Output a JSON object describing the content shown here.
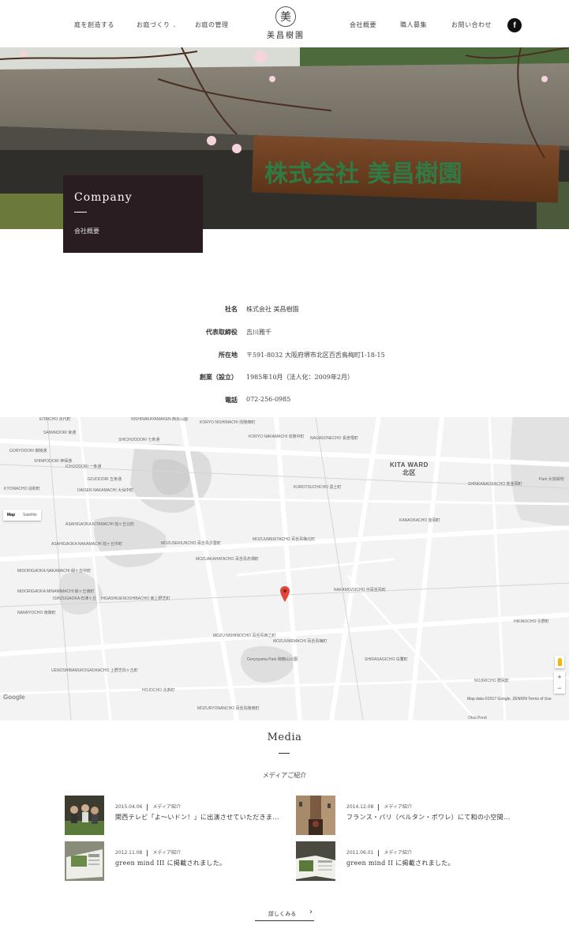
{
  "header": {
    "nav_left": [
      {
        "label": "庭を創造する"
      },
      {
        "label": "お庭づくり",
        "has_dropdown": true
      },
      {
        "label": "お庭の管理"
      }
    ],
    "logo_mark": "美",
    "logo_text": "美昌樹園",
    "nav_right": [
      {
        "label": "会社概要"
      },
      {
        "label": "職人募集"
      },
      {
        "label": "お問い合わせ"
      }
    ],
    "facebook_glyph": "f",
    "icons": {
      "facebook": "facebook-icon",
      "dropdown": "chevron-down-icon"
    }
  },
  "hero": {
    "title": "Company",
    "subtitle": "会社概要",
    "sign_text": "株式会社 美昌樹園",
    "label_bg": "#2a1d22"
  },
  "company_info": [
    {
      "label": "社名",
      "value": "株式会社 美昌樹園"
    },
    {
      "label": "代表取締役",
      "value": "吉川雅千"
    },
    {
      "label": "所在地",
      "value": "〒591-8032 大阪府堺市北区百舌鳥梅町1-18-15"
    },
    {
      "label": "創業（設立）",
      "value": "1985年10月（法人化：2009年2月）"
    },
    {
      "label": "電話",
      "value": "072-256-0985"
    }
  ],
  "map": {
    "toggle": {
      "map": "Map",
      "satellite": "Satellite"
    },
    "district": "KITA WARD",
    "district_jp": "北区",
    "labels": [
      "EITAICHO 永代町",
      "NISHINAKAYAMAKEN 西永山園",
      "KORYO NISHIMACHI 向陵西町",
      "KORYO NAKAMACHI 向陵中町",
      "NAGASONECHO 長曽根町",
      "SAIWAIDORI 幸通",
      "GORYODORI 御陵通",
      "SHICHIJODORI 七条通",
      "SHINPODORI 神保通",
      "ICHIJODORI 一条通",
      "GOJODORI 五条通",
      "DAISEN NAKAMACHI 大仙中町",
      "KYOWACHO 協和町",
      "KUROTSUCHICHO 黒土町",
      "SHINKANAOKACHO 新金岡町",
      "KANAOKACHO 金岡町",
      "ASAHIGAOKA KITAMACHI 旭ヶ丘北町",
      "ASAHIGAOKA NAKAMACHI 旭ヶ丘中町",
      "MOZUSEKIUNCHO 百舌鳥夕雲町",
      "MOZUUMEKITACHO 百舌鳥梅北町",
      "MOZUAKAHATACHO 百舌鳥赤畑町",
      "MIDORIGAOKA NAKAMACHI 緑ヶ丘中町",
      "MIDORIGAOKA MINAMIMACHI 緑ヶ丘南町",
      "ISHIZUGAOKA 石津ヶ丘",
      "HIGASHIUENOSHIBACHO 東上野芝町",
      "NAKAMOZUCHO 中百舌鳥町",
      "NANRYOCHO 南陵町",
      "MOZU NISHINOCHO 百舌鳥西之町",
      "MOZUUMEMACHI 百舌鳥梅町",
      "HIKINOCHO 引野町",
      "Goryoyama Park 御廟山公園",
      "SHIRASAGICHO 白鷺町",
      "NOJIRICHO 野尻町",
      "UENOSHIBAMUKOGAOKACHO 上野芝向ヶ丘町",
      "HOJOCHO 北条町",
      "MOZURYONANCHO 百舌鳥陵南町",
      "Otsu Pond",
      "Park 大泉緑地"
    ],
    "google": "Google",
    "credits": "Map data ©2017 Google, ZENRIN   Terms of Use",
    "zoom_in": "+",
    "zoom_out": "−",
    "pin_color": "#e0463a"
  },
  "media": {
    "title": "Media",
    "subtitle": "メディアご紹介",
    "items": [
      {
        "date": "2015.04.06",
        "category": "メディア紹介",
        "text": "関西テレビ「よ〜いドン！」に出演させていただきま..."
      },
      {
        "date": "2014.12.08",
        "category": "メディア紹介",
        "text": "フランス・パリ（ベルタン・ポワレ）にて和の小空間..."
      },
      {
        "date": "2012.11.08",
        "category": "メディア紹介",
        "text": "green mind III に掲載されました。"
      },
      {
        "date": "2011.06.01",
        "category": "メディア紹介",
        "text": "green mind II に掲載されました。"
      }
    ],
    "more_label": "詳しくみる",
    "more_arrow": "›"
  }
}
